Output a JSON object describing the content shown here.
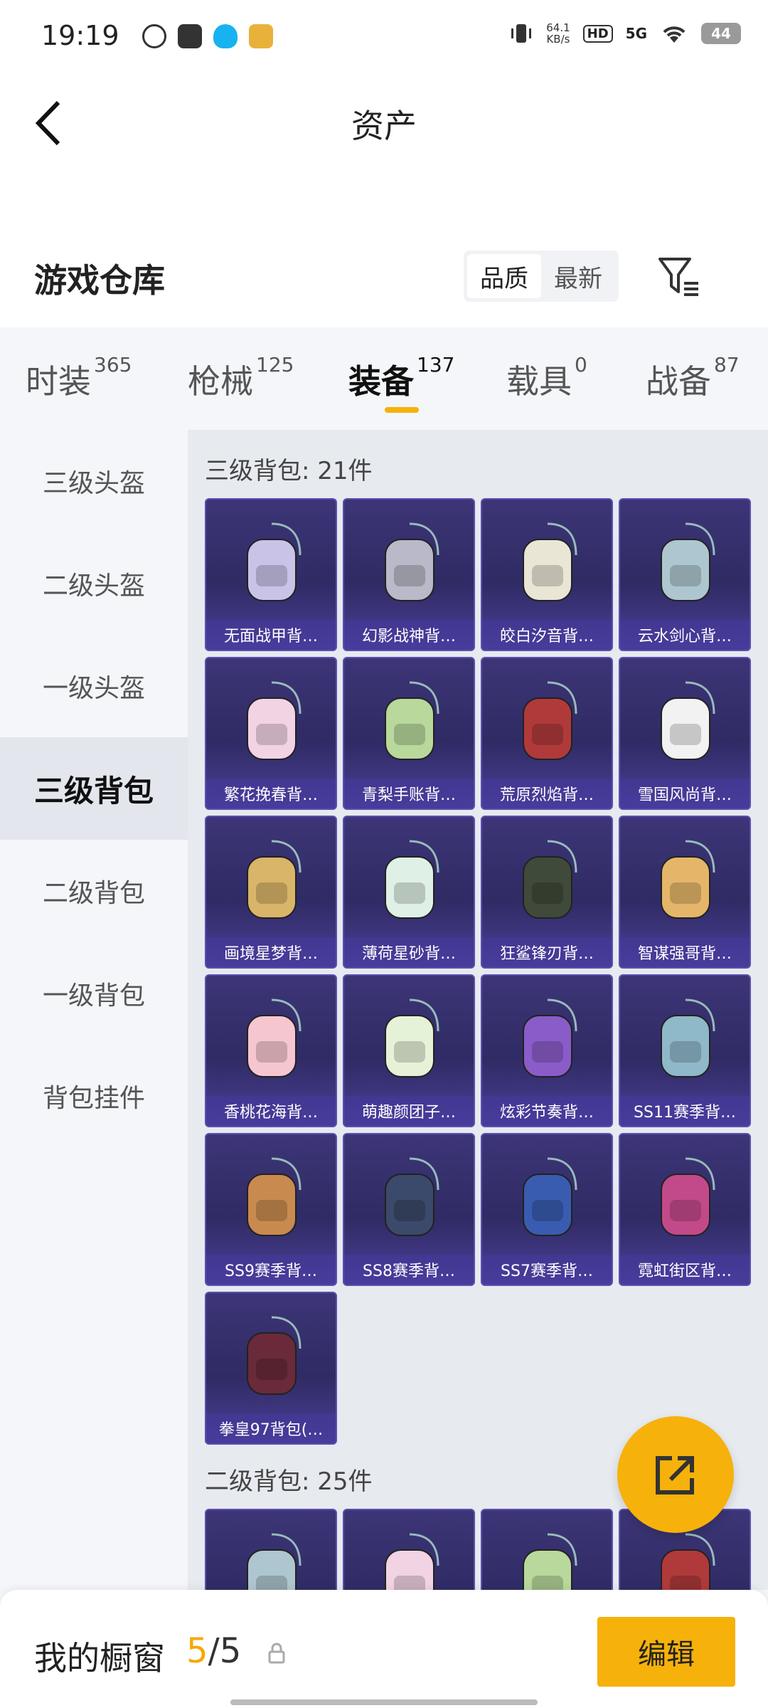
{
  "status_bar": {
    "time": "19:19",
    "net_speed_value": "64.1",
    "net_speed_unit": "KB/s",
    "hd": "HD",
    "signal": "5G",
    "battery": "44",
    "icons": [
      "leaf-app-icon",
      "mail-app-icon",
      "qq-penguin-icon",
      "game-app-icon",
      "vibrate-icon",
      "wifi-icon"
    ]
  },
  "header": {
    "title": "资产"
  },
  "repository": {
    "title": "游戏仓库",
    "sort_options": [
      "品质",
      "最新"
    ],
    "sort_active": "品质"
  },
  "category_tabs": [
    {
      "label": "时装",
      "count": "365"
    },
    {
      "label": "枪械",
      "count": "125"
    },
    {
      "label": "装备",
      "count": "137",
      "active": true
    },
    {
      "label": "载具",
      "count": "0"
    },
    {
      "label": "战备",
      "count": "87"
    }
  ],
  "sidebar": {
    "items": [
      "三级头盔",
      "二级头盔",
      "一级头盔",
      "三级背包",
      "二级背包",
      "一级背包",
      "背包挂件"
    ],
    "active": "三级背包"
  },
  "sections": [
    {
      "title": "三级背包: 21件",
      "items": [
        "无面战甲背…",
        "幻影战神背…",
        "皎白汐音背…",
        "云水剑心背…",
        "繁花挽春背…",
        "青梨手账背…",
        "荒原烈焰背…",
        "雪国风尚背…",
        "画境星梦背…",
        "薄荷星砂背…",
        "狂鲨锋刃背…",
        "智谋强哥背…",
        "香桃花海背…",
        "萌趣颜团子…",
        "炫彩节奏背…",
        "SS11赛季背…",
        "SS9赛季背…",
        "SS8赛季背…",
        "SS7赛季背…",
        "霓虹街区背…",
        "拳皇97背包(…"
      ]
    },
    {
      "title": "二级背包: 25件",
      "items": [
        "",
        "",
        "",
        ""
      ]
    }
  ],
  "bottom_bar": {
    "label": "我的橱窗",
    "current": "5",
    "separator": "/",
    "total": "5",
    "edit_label": "编辑"
  },
  "colors": {
    "accent": "#f6b10a",
    "tile_bg": "#332d6c",
    "sidebar_active_bg": "#e3e6ec"
  }
}
